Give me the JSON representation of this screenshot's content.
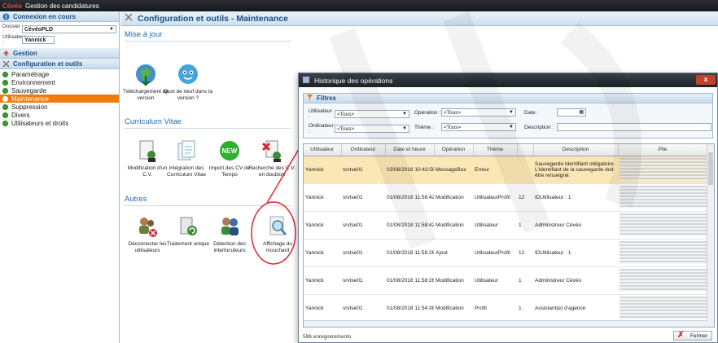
{
  "app": {
    "logo": "Cévéo",
    "title": "Gestion des candidatures"
  },
  "left": {
    "connexion": {
      "title": "Connexion en cours",
      "dossier_label": "Dossier :",
      "dossier_value": "CévéoPLD",
      "user_label": "Utilisateur :",
      "user_value": "Yannick"
    },
    "gestion_label": "Gestion",
    "config_label": "Configuration et outils",
    "items": [
      {
        "label": "Paramétrage"
      },
      {
        "label": "Environnement"
      },
      {
        "label": "Sauvegarde"
      },
      {
        "label": "Maintenance"
      },
      {
        "label": "Suppression"
      },
      {
        "label": "Divers"
      },
      {
        "label": "Utilisateurs et droits"
      }
    ]
  },
  "main": {
    "title": "Configuration et outils - Maintenance",
    "groups": {
      "miseajour": "Mise à jour",
      "cv": "Curriculum Vitae",
      "autres": "Autres"
    },
    "tiles_miseajour": [
      {
        "label": "Téléchargement de version"
      },
      {
        "label": "Quoi de neuf dans la version ?"
      }
    ],
    "tiles_cv": [
      {
        "label": "Modification d'un C.V."
      },
      {
        "label": "Intégration des Curriculum Vitae"
      },
      {
        "label": "Import des CV de Tempo"
      },
      {
        "label": "Recherche des C.V. en doublon"
      }
    ],
    "tiles_autres": [
      {
        "label": "Déconnecter les utilisateurs"
      },
      {
        "label": "Traitement unique"
      },
      {
        "label": "Détection des interlocuteurs"
      },
      {
        "label": "Affichage du mouchard"
      }
    ]
  },
  "dialog": {
    "title": "Historique des opérations",
    "close": "x",
    "filters": {
      "title": "Filtres",
      "utilisateur_label": "Utilisateur :",
      "utilisateur_value": "<Tous>",
      "operation_label": "Opération :",
      "operation_value": "<Tous>",
      "date_label": "Date :",
      "ordinateur_label": "Ordinateur :",
      "ordinateur_value": "<Tous>",
      "theme_label": "Thème :",
      "theme_value": "<Tous>",
      "description_label": "Description :"
    },
    "columns": [
      "Utilisateur",
      "Ordinateur",
      "Date et heure",
      "Opération",
      "Thème",
      "",
      "Description",
      "Pile"
    ],
    "rows": [
      {
        "user": "Yannick",
        "pc": "srvtse01",
        "date": "02/08/2018 10:43:58",
        "op": "MessageBox",
        "theme": "Erreur",
        "n": "",
        "desc": "Sauvegarde Identifiant obligatoire L'identifiant de la sauvegarde doit être renseigné."
      },
      {
        "user": "Yannick",
        "pc": "srvtse01",
        "date": "01/08/2018 11:58:42",
        "op": "Modification",
        "theme": "UtilisateurProfil",
        "n": "12",
        "desc": "IDUtilisateur : 1"
      },
      {
        "user": "Yannick",
        "pc": "srvtse01",
        "date": "01/08/2018 11:58:42",
        "op": "Modification",
        "theme": "Utilisateur",
        "n": "1",
        "desc": "Administreur Cévéo"
      },
      {
        "user": "Yannick",
        "pc": "srvtse01",
        "date": "01/08/2018 11:58:26",
        "op": "Ajout",
        "theme": "UtilisateurProfil",
        "n": "12",
        "desc": "IDUtilisateur : 1"
      },
      {
        "user": "Yannick",
        "pc": "srvtse01",
        "date": "01/08/2018 11:58:26",
        "op": "Modification",
        "theme": "Utilisateur",
        "n": "1",
        "desc": "Administreur Cévéo"
      },
      {
        "user": "Yannick",
        "pc": "srvtse01",
        "date": "01/08/2018 11:54:38",
        "op": "Modification",
        "theme": "Profil",
        "n": "1",
        "desc": "Assistant(e) d'agence"
      }
    ],
    "count": "596 enregistrements",
    "fermer": "Fermer"
  },
  "colors": {
    "accent": "#1d4f82",
    "active": "#f07c10",
    "selected_row": "#fbe6b5",
    "annotation": "#e0262e"
  }
}
